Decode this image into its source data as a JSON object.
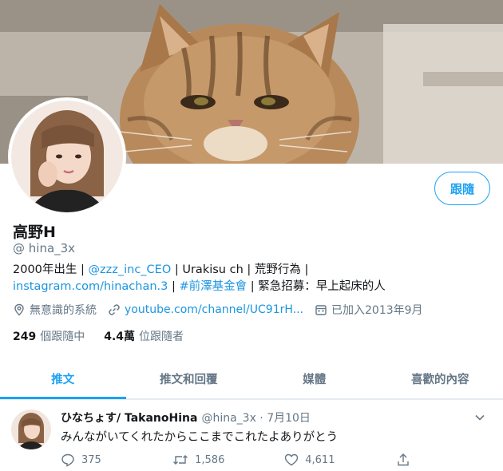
{
  "profile": {
    "display_name": "高野H",
    "handle": "@ hina_3x",
    "follow_label": "跟隨",
    "bio": {
      "line1_a": "2000年出生 | ",
      "line1_link": "@zzz_inc_CEO",
      "line1_b": " | Urakisu ch | 荒野行為 |",
      "line2_link1": "instagram.com/hinachan.3",
      "line2_sep": " | ",
      "line2_link2": "#前澤基金會",
      "line2_b": " | 緊急招募：早上起床的人"
    },
    "meta": {
      "location": "無意識的系統",
      "website": "youtube.com/channel/UC91rH...",
      "joined": "已加入2013年9月"
    },
    "stats": {
      "following_count": "249",
      "following_label": "個跟隨中",
      "followers_count": "4.4萬",
      "followers_label": "位跟隨者"
    }
  },
  "tabs": [
    {
      "label": "推文",
      "active": true
    },
    {
      "label": "推文和回覆",
      "active": false
    },
    {
      "label": "媒體",
      "active": false
    },
    {
      "label": "喜歡的內容",
      "active": false
    }
  ],
  "tweet": {
    "author_name": "ひなちょす/ TakanoHina",
    "author_handle": "@hina_3x · 7月10日",
    "text": "みんながいてくれたからここまでこれたよありがとう",
    "replies": "375",
    "retweets": "1,586",
    "likes": "4,611"
  },
  "colors": {
    "accent": "#1da1f2",
    "link": "#1b95e0",
    "muted": "#657786"
  }
}
